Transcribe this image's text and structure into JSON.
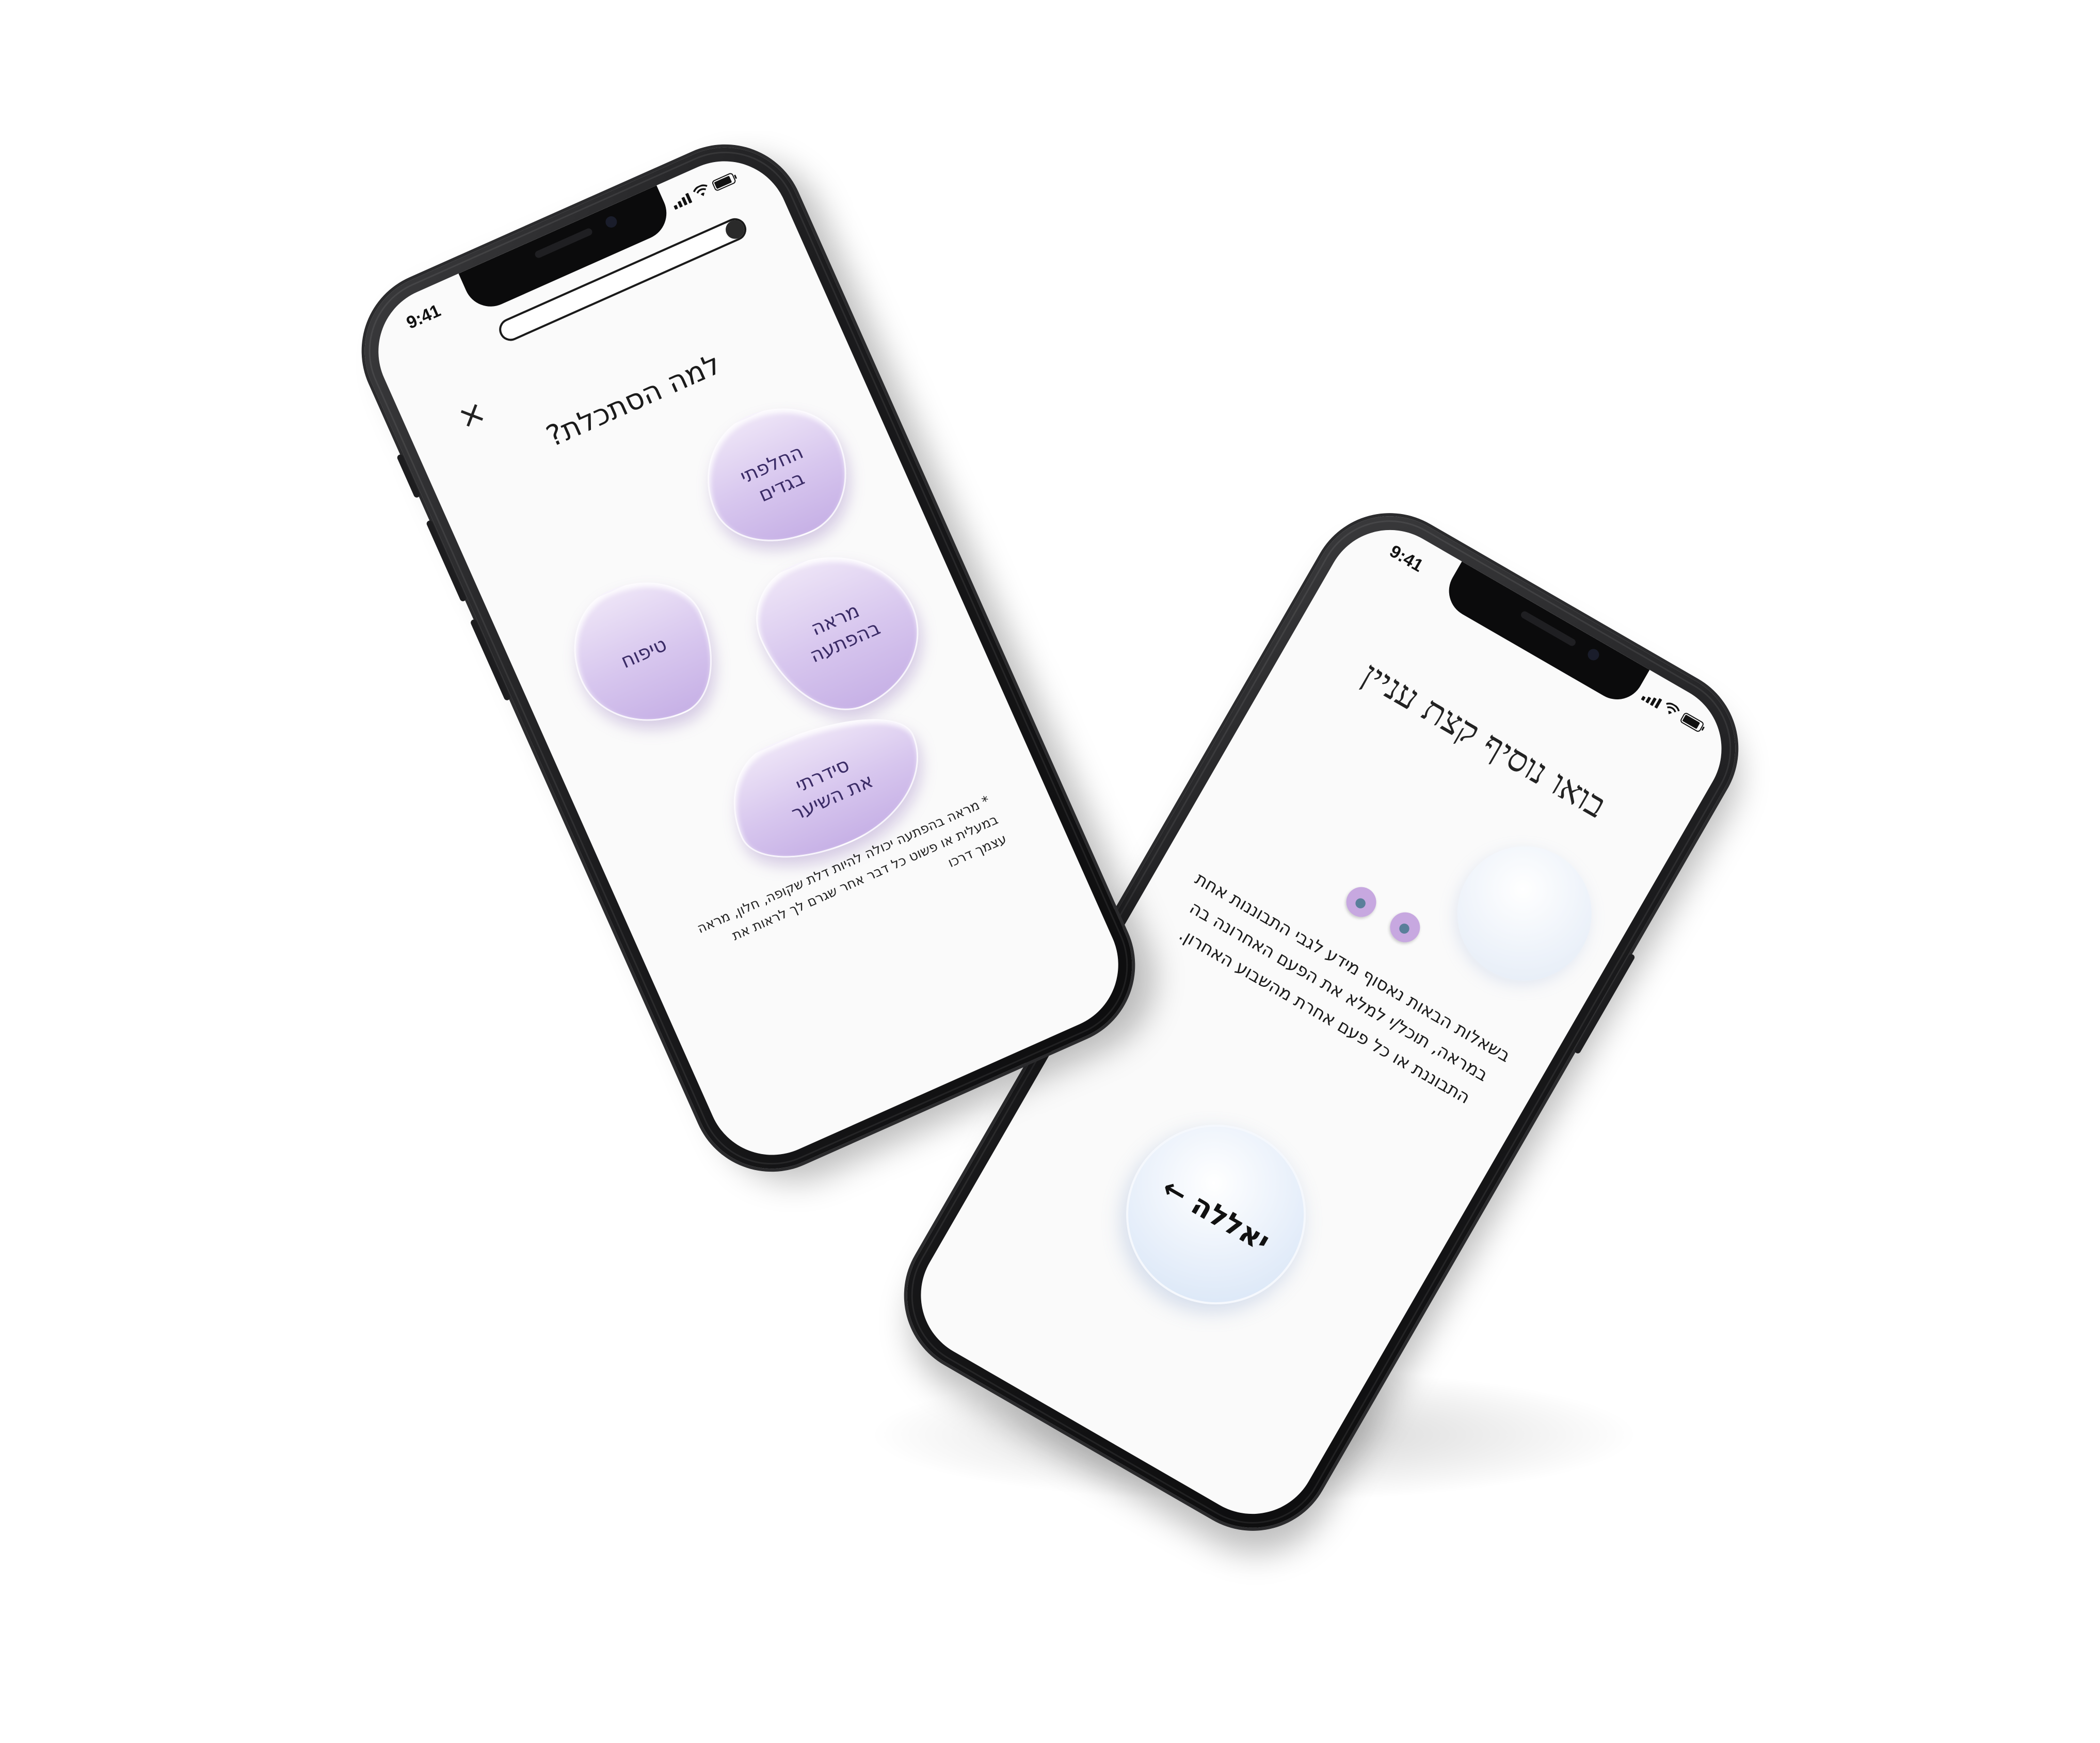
{
  "phone_left": {
    "status_time": "9:41",
    "progress_fraction": 0.07,
    "close_glyph": "×",
    "question": "למה הסתכלת?",
    "options": [
      {
        "line1": "החלפתי",
        "line2": "בגדים"
      },
      {
        "line1": "טיפוח",
        "line2": ""
      },
      {
        "line1": "מראה",
        "line2": "בהפתעה"
      },
      {
        "line1": "סידרתי",
        "line2": "את השיער"
      }
    ],
    "footnote": "* מראה בהפתעה יכולה להיות דלת שקופה, חלון, מראה במעלית או פשוט כל דבר אחר שגרם לך לראות את עצמך דרכו"
  },
  "phone_right": {
    "status_time": "9:41",
    "headline": "בואו נוסיף קצת עניין",
    "body": "בשאלות הבאות נאסוף מידע לגבי התבוננות אחת במראה, תוכל/י למלא את הפעם האחרונה בה התבוננת או כל פעם אחרת מהשבוע האחרון.",
    "cta_label": "יאללה",
    "cta_arrow": "←"
  },
  "colors": {
    "blob_light": "#eee5f7",
    "blob_dark": "#c7b1e6",
    "blob_text": "#3a2b66",
    "cta_tint": "#d3e2f5",
    "phone_frame": "#1b1b1d",
    "screen_bg": "#fafafa"
  }
}
